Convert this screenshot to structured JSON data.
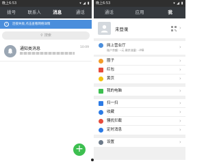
{
  "left": {
    "status_time": "晚上6:53",
    "status_icons": "▾ ◢ ▮",
    "tabs": [
      "拨号",
      "联系人",
      "消息",
      "通话"
    ],
    "active_tab_index": 2,
    "banner": "连接失败,点击查看网络详情",
    "search_placeholder": "搜索",
    "notification": {
      "title": "通知类消息",
      "time": "10:09"
    },
    "fab_label": "+"
  },
  "right": {
    "status_time": "晚上6:53",
    "status_icons": "▾ ◢ ▮",
    "tabs": [
      "通话",
      "应用",
      "我"
    ],
    "active_tab_index": 2,
    "profile_name": "未登录",
    "business": {
      "label": "网上营业厅",
      "sub": "账户余额: --元   剩余流量: --MB"
    },
    "menu": [
      {
        "label": "圈子",
        "color": "#f39c2a",
        "icon": "circle-icon"
      },
      {
        "label": "红包",
        "color": "#e74c3c",
        "icon": "red-packet-icon"
      },
      {
        "label": "黄页",
        "color": "#f1c40f",
        "icon": "yellow-pages-icon"
      },
      {
        "label": "我的电脑",
        "color": "#3dbf50",
        "icon": "computer-icon"
      },
      {
        "label": "扫一扫",
        "color": "#2c7be5",
        "icon": "scan-icon"
      },
      {
        "label": "收藏",
        "color": "#2c7be5",
        "icon": "star-icon"
      },
      {
        "label": "骚扰拦截",
        "color": "#e74c3c",
        "icon": "block-icon"
      },
      {
        "label": "定时消息",
        "color": "#2c7be5",
        "icon": "clock-icon"
      },
      {
        "label": "设置",
        "color": "#6c7a89",
        "icon": "gear-icon"
      }
    ]
  }
}
